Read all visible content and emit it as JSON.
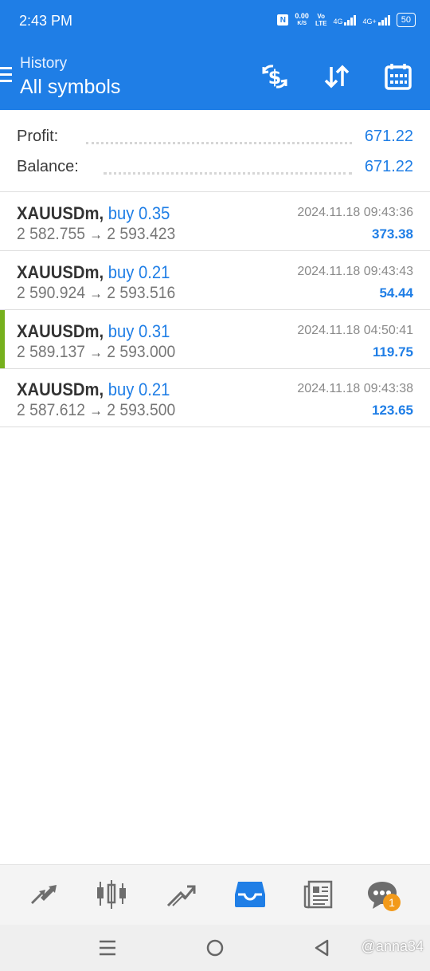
{
  "status_bar": {
    "time": "2:43 PM",
    "net_speed": "0.00",
    "net_unit": "K/S",
    "volte": "Vo",
    "lte": "LTE",
    "sig1": "4G",
    "sig2": "4G+",
    "battery": "50"
  },
  "header": {
    "title": "History",
    "subtitle": "All symbols",
    "actions": [
      "dollar-sync-icon",
      "sort-icon",
      "calendar-icon"
    ]
  },
  "summary": {
    "profit_label": "Profit:",
    "profit_value": "671.22",
    "balance_label": "Balance:",
    "balance_value": "671.22"
  },
  "trades": [
    {
      "symbol": "XAUUSDm,",
      "side": "buy 0.35",
      "open": "2 582.755",
      "arrow": "→",
      "close": "2 593.423",
      "time": "2024.11.18 09:43:36",
      "profit": "373.38"
    },
    {
      "symbol": "XAUUSDm,",
      "side": "buy 0.21",
      "open": "2 590.924",
      "arrow": "→",
      "close": "2 593.516",
      "time": "2024.11.18 09:43:43",
      "profit": "54.44"
    },
    {
      "symbol": "XAUUSDm,",
      "side": "buy 0.31",
      "open": "2 589.137",
      "arrow": "→",
      "close": "2 593.000",
      "time": "2024.11.18 04:50:41",
      "profit": "119.75"
    },
    {
      "symbol": "XAUUSDm,",
      "side": "buy 0.21",
      "open": "2 587.612",
      "arrow": "→",
      "close": "2 593.500",
      "time": "2024.11.18 09:43:38",
      "profit": "123.65"
    }
  ],
  "bottom_nav": {
    "items": [
      "quotes-icon",
      "chart-icon",
      "trade-icon",
      "history-icon",
      "news-icon",
      "chat-icon"
    ],
    "active": "history-icon",
    "chat_badge": "1"
  },
  "watermark": "@anna34",
  "colors": {
    "header_bg": "#1f7ee6",
    "accent": "#1f7ee6",
    "highlight_marker": "#76b01d",
    "badge": "#f29a1b"
  }
}
